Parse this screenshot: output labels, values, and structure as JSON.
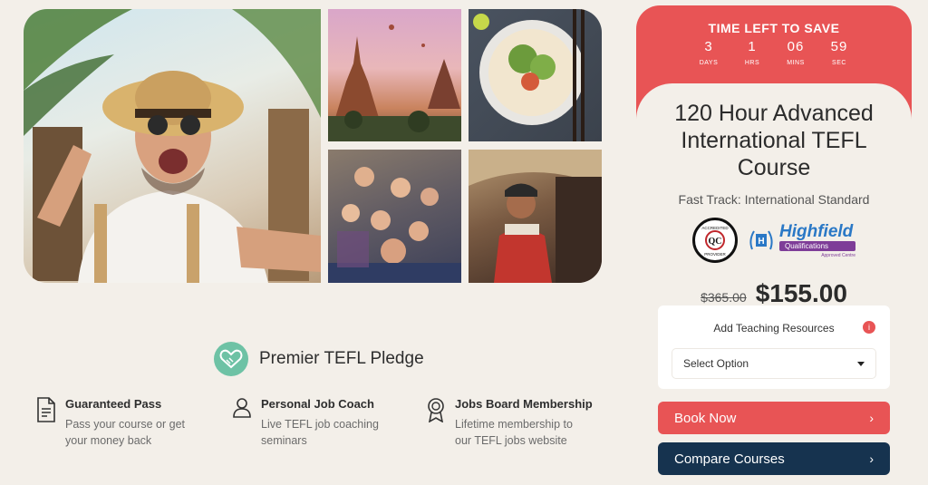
{
  "gallery": {
    "images": [
      "traveler-selfie",
      "temple-sunset",
      "noodle-bowl",
      "classroom-group",
      "tribal-woman"
    ]
  },
  "pledge": {
    "title": "Premier TEFL Pledge",
    "features": [
      {
        "title": "Guaranteed Pass",
        "desc": "Pass your course or get your money back",
        "icon": "document-icon"
      },
      {
        "title": "Personal Job Coach",
        "desc": "Live TEFL job coaching seminars",
        "icon": "person-icon"
      },
      {
        "title": "Jobs Board Membership",
        "desc": "Lifetime membership to our TEFL jobs website",
        "icon": "award-icon"
      }
    ]
  },
  "timer": {
    "title": "TIME LEFT TO SAVE",
    "units": [
      {
        "value": "3",
        "label": "DAYS"
      },
      {
        "value": "1",
        "label": "HRS"
      },
      {
        "value": "06",
        "label": "MINS"
      },
      {
        "value": "59",
        "label": "SEC"
      }
    ]
  },
  "course": {
    "title_line1": "120 Hour Advanced",
    "title_line2": "International TEFL",
    "title_line3": "Course",
    "subtitle": "Fast Track: International Standard",
    "accreditation": {
      "badge_top": "ACCREDITED",
      "badge_mid": "QC",
      "badge_bottom": "PROVIDER",
      "highfield_word": "Highfield",
      "highfield_sub": "Qualifications",
      "highfield_small": "Approved Centre"
    },
    "old_price": "$365.00",
    "new_price": "$155.00"
  },
  "add_resources": {
    "label": "Add Teaching Resources",
    "info": "i",
    "select_value": "Select Option"
  },
  "buttons": {
    "book": "Book Now",
    "compare": "Compare Courses",
    "chevron": "›"
  },
  "colors": {
    "accent": "#e85455",
    "navy": "#16334f",
    "pledge": "#6ec2a5",
    "background": "#f3efe9"
  }
}
